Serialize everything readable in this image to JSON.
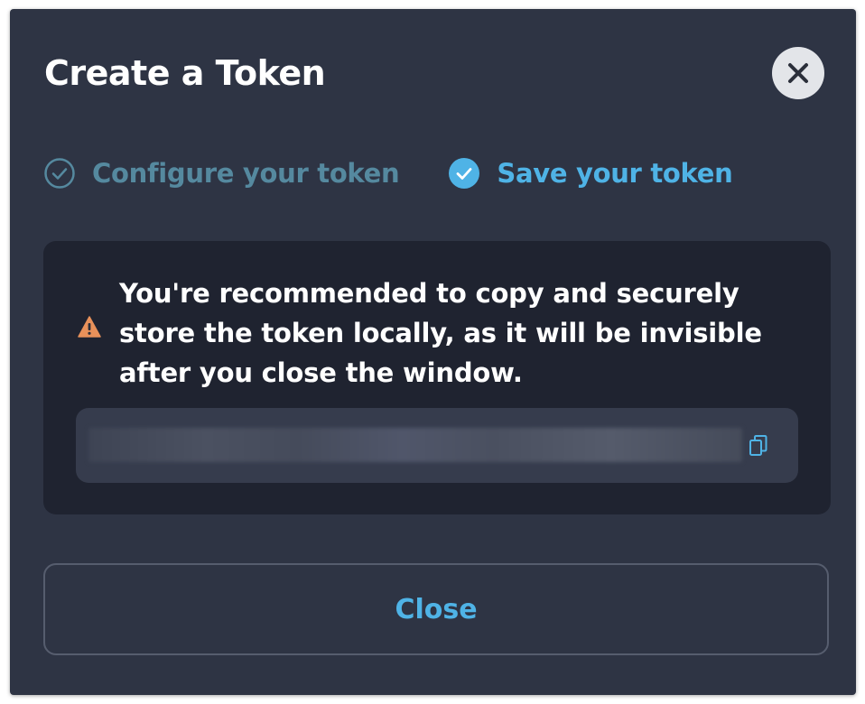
{
  "dialog": {
    "title": "Create a Token",
    "close_icon": "close-x-icon"
  },
  "steps": [
    {
      "label": "Configure your token",
      "state": "done",
      "icon": "check-circle-outline-icon"
    },
    {
      "label": "Save your token",
      "state": "active",
      "icon": "check-circle-filled-icon"
    }
  ],
  "notice": {
    "icon": "warning-icon",
    "text": "You're recommended to copy and securely store the token locally, as it will be invisible after you close the window."
  },
  "token": {
    "copy_icon": "copy-icon"
  },
  "footer": {
    "close_label": "Close"
  },
  "colors": {
    "dialog_bg": "#2e3444",
    "panel_bg": "#1f2330",
    "accent": "#4fb3e6",
    "step_done": "#55899f",
    "warning": "#e8915a"
  }
}
